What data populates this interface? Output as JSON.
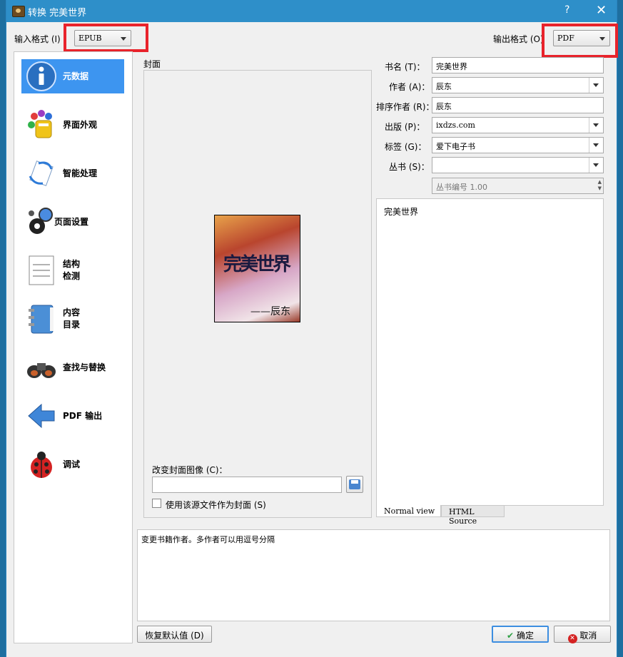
{
  "window": {
    "title": "转换 完美世界",
    "help": "?",
    "close": "✕"
  },
  "header": {
    "input_format_label": "输入格式 (I)",
    "input_format_value": "EPUB",
    "output_format_label": "输出格式 (O)",
    "output_format_value": "PDF"
  },
  "sidebar": {
    "items": [
      {
        "label": "元数据",
        "icon": "info-icon"
      },
      {
        "label": "界面外观",
        "icon": "paint-icon"
      },
      {
        "label": "智能处理",
        "icon": "heuristics-icon"
      },
      {
        "label": "页面设置",
        "icon": "gears-icon"
      },
      {
        "label": "结构",
        "label2": "检测",
        "icon": "document-icon"
      },
      {
        "label": "内容",
        "label2": "目录",
        "icon": "notebook-icon"
      },
      {
        "label": "查找与替换",
        "icon": "binoculars-icon"
      },
      {
        "label": "PDF 输出",
        "icon": "left-arrow-icon"
      },
      {
        "label": "调试",
        "icon": "ladybug-icon"
      }
    ]
  },
  "cover": {
    "label": "封面",
    "cover_title": "完美世界",
    "cover_author": "——辰东",
    "change_cover_label": "改变封面图像 (C)：",
    "change_cover_value": "",
    "use_source_label": "使用该源文件作为封面 (S)"
  },
  "metadata": {
    "title_label": "书名 (T)：",
    "title_value": "完美世界",
    "author_label": "作者 (A)：",
    "author_value": "辰东",
    "author_sort_label": "排序作者 (R)：",
    "author_sort_value": "辰东",
    "publisher_label": "出版 (P)：",
    "publisher_value": "ixdzs.com",
    "tags_label": "标签 (G)：",
    "tags_value": "爱下电子书",
    "series_label": "丛书 (S)：",
    "series_value": "",
    "series_index_value": "丛书编号 1.00",
    "comments_text": "完美世界",
    "tab_normal": "Normal view",
    "tab_html": "HTML Source"
  },
  "help_text": "变更书籍作者。多作者可以用逗号分隔",
  "buttons": {
    "restore_defaults": "恢复默认值 (D)",
    "ok": "确定",
    "cancel": "取消"
  },
  "colors": {
    "accent": "#3d95f0",
    "titlebar": "#2e8fc9",
    "highlight_box": "#e8232b"
  }
}
